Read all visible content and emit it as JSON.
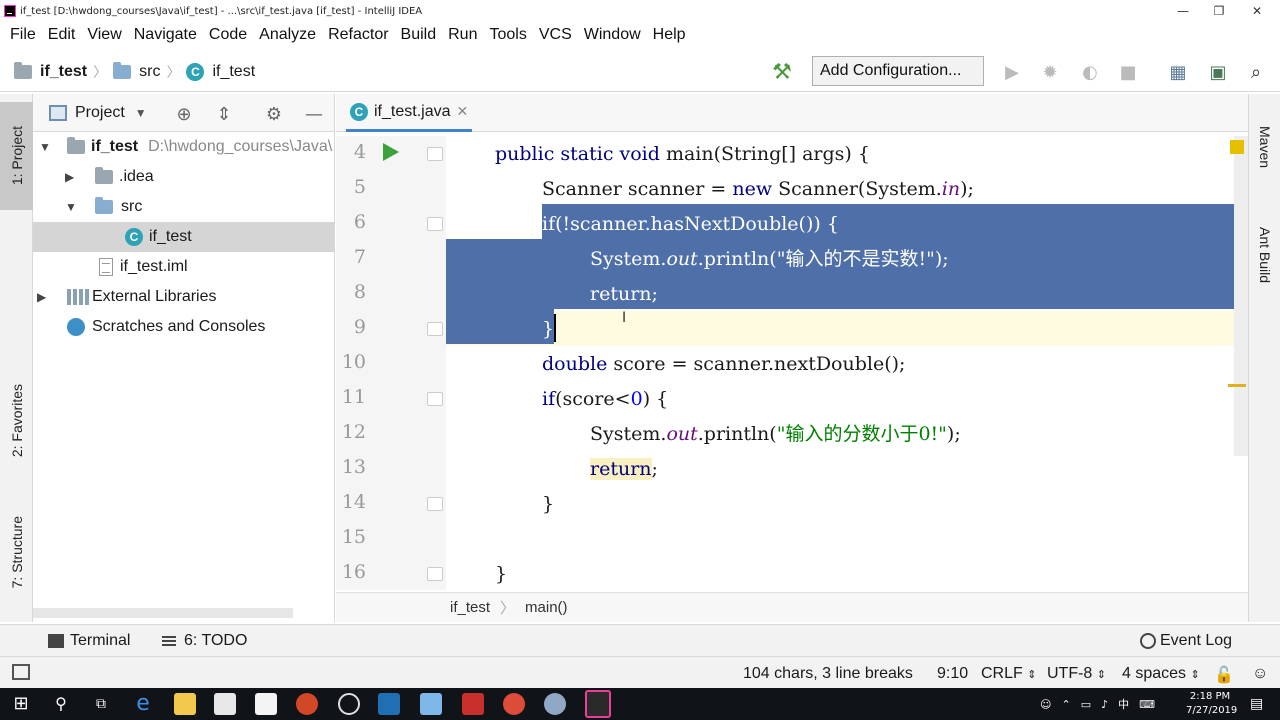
{
  "window": {
    "title": "if_test [D:\\hwdong_courses\\Java\\if_test] - ...\\src\\if_test.java [if_test] - IntelliJ IDEA",
    "minimize": "—",
    "restore": "❐",
    "close": "✕"
  },
  "menu": [
    "File",
    "Edit",
    "View",
    "Navigate",
    "Code",
    "Analyze",
    "Refactor",
    "Build",
    "Run",
    "Tools",
    "VCS",
    "Window",
    "Help"
  ],
  "nav": {
    "breadcrumb": [
      "if_test",
      "src",
      "if_test"
    ],
    "add_configuration": "Add Configuration..."
  },
  "side_tabs": {
    "project": "1: Project",
    "favorites": "2: Favorites",
    "structure": "7: Structure",
    "maven": "Maven",
    "ant": "Ant Build"
  },
  "project_panel": {
    "title": "Project",
    "tree": [
      {
        "label": "if_test",
        "path": "D:\\hwdong_courses\\Java\\"
      },
      {
        "label": ".idea"
      },
      {
        "label": "src"
      },
      {
        "label": "if_test"
      },
      {
        "label": "if_test.iml"
      },
      {
        "label": "External Libraries"
      },
      {
        "label": "Scratches and Consoles"
      }
    ]
  },
  "editor": {
    "tab": "if_test.java",
    "line_numbers": [
      "4",
      "5",
      "6",
      "7",
      "8",
      "9",
      "10",
      "11",
      "12",
      "13",
      "14",
      "15",
      "16"
    ],
    "code": {
      "l4_kw": "public static void",
      "l4_rest": " main(String[] args) {",
      "l5_a": "Scanner scanner = ",
      "l5_kw": "new",
      "l5_b": " Scanner(System.",
      "l5_it": "in",
      "l5_c": ");",
      "l6": "if(!scanner.hasNextDouble()) {",
      "l7_a": "System.",
      "l7_it": "out",
      "l7_b": ".println(",
      "l7_str": "\"输入的不是实数!\"",
      "l7_c": ");",
      "l8": "return;",
      "l9": "}",
      "l10_kw": "double",
      "l10_rest": " score = scanner.nextDouble();",
      "l11_kw": "if",
      "l11_a": "(score<",
      "l11_num": "0",
      "l11_b": ") {",
      "l12_a": "System.",
      "l12_it": "out",
      "l12_b": ".println(",
      "l12_str": "\"输入的分数小于0!\"",
      "l12_c": ");",
      "l13_kw": "return",
      "l13_b": ";",
      "l14": "}",
      "l16": "}"
    },
    "breadcrumb": [
      "if_test",
      "main()"
    ]
  },
  "bottom_tools": {
    "terminal": "Terminal",
    "todo": "6: TODO",
    "event_log": "Event Log"
  },
  "status": {
    "selection": "104 chars, 3 line breaks",
    "position": "9:10",
    "line_sep": "CRLF",
    "encoding": "UTF-8",
    "indent": "4 spaces"
  },
  "taskbar": {
    "time": "2:18 PM",
    "date": "7/27/2019",
    "ime": "中"
  },
  "colors": {
    "selection": "#4f6fa9",
    "keyword": "#000080",
    "string": "#008000",
    "current_line": "#fffbe0"
  }
}
